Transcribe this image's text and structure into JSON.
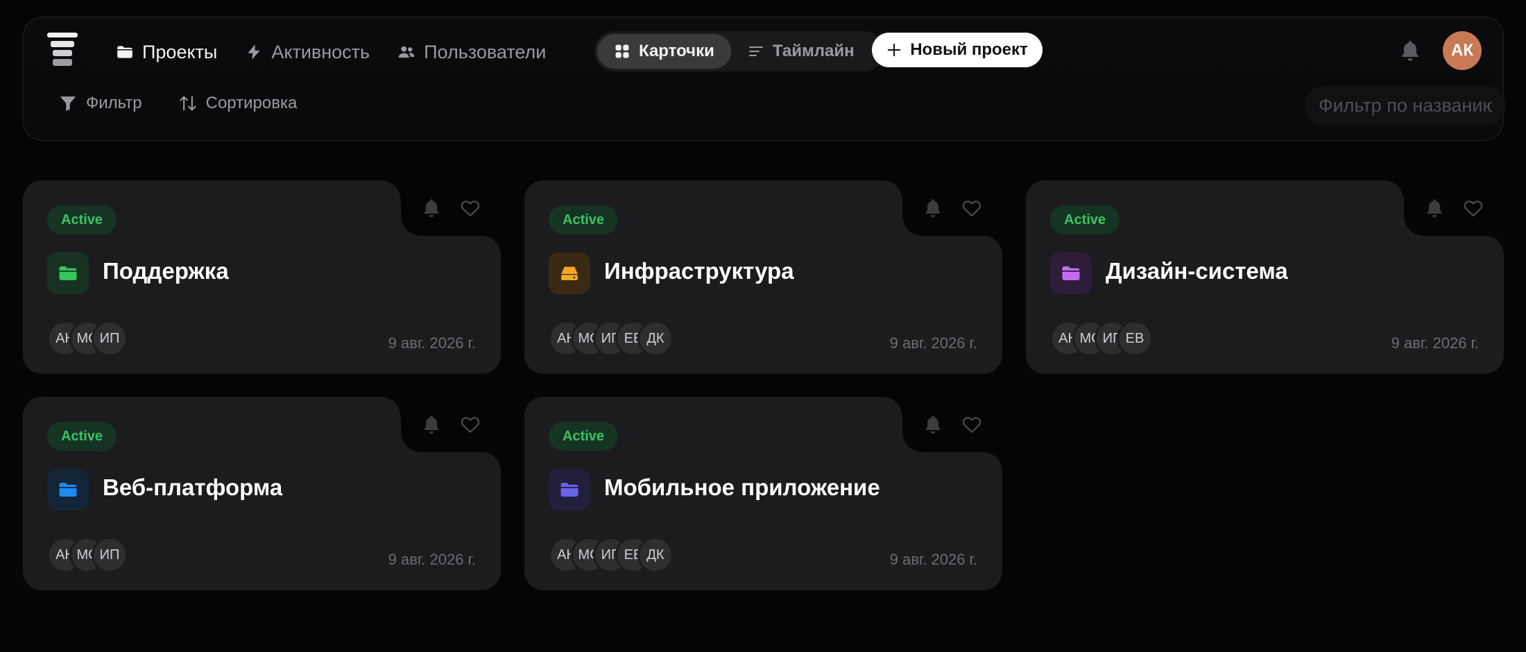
{
  "nav": {
    "items": [
      {
        "label": "Проекты",
        "active": true,
        "icon": "folder-icon"
      },
      {
        "label": "Активность",
        "active": false,
        "icon": "bolt-icon"
      },
      {
        "label": "Пользователи",
        "active": false,
        "icon": "users-icon"
      }
    ]
  },
  "view_toggle": {
    "cards_label": "Карточки",
    "timeline_label": "Таймлайн",
    "selected": "Карточки"
  },
  "new_project_label": "Новый проект",
  "user": {
    "initials": "АК",
    "avatar_color": "#c77a55"
  },
  "toolbar": {
    "filter_label": "Фильтр",
    "sort_label": "Сортировка",
    "search_placeholder": "Фильтр по названию",
    "search_value": ""
  },
  "projects": [
    {
      "status": "Active",
      "title": "Поддержка",
      "icon": "folder-icon",
      "icon_color": "#34c759",
      "icon_bg": "#173222",
      "members": [
        "АН",
        "МС",
        "ИП"
      ],
      "date": "9 авг. 2026 г."
    },
    {
      "status": "Active",
      "title": "Инфраструктура",
      "icon": "server-icon",
      "icon_color": "#f5a623",
      "icon_bg": "#3a2a14",
      "members": [
        "АН",
        "МС",
        "ИП",
        "ЕВ",
        "ДК"
      ],
      "date": "9 авг. 2026 г."
    },
    {
      "status": "Active",
      "title": "Дизайн-система",
      "icon": "folder-icon",
      "icon_color": "#c26cf2",
      "icon_bg": "#2e1d3a",
      "members": [
        "АН",
        "МС",
        "ИП",
        "ЕВ"
      ],
      "date": "9 авг. 2026 г."
    },
    {
      "status": "Active",
      "title": "Веб-платформа",
      "icon": "folder-icon",
      "icon_color": "#1e8bf2",
      "icon_bg": "#132638",
      "members": [
        "АН",
        "МС",
        "ИП"
      ],
      "date": "9 авг. 2026 г."
    },
    {
      "status": "Active",
      "title": "Мобильное приложение",
      "icon": "folder-icon",
      "icon_color": "#6b63e6",
      "icon_bg": "#221f3c",
      "members": [
        "АН",
        "МС",
        "ИП",
        "ЕВ",
        "ДК"
      ],
      "date": "9 авг. 2026 г."
    }
  ]
}
